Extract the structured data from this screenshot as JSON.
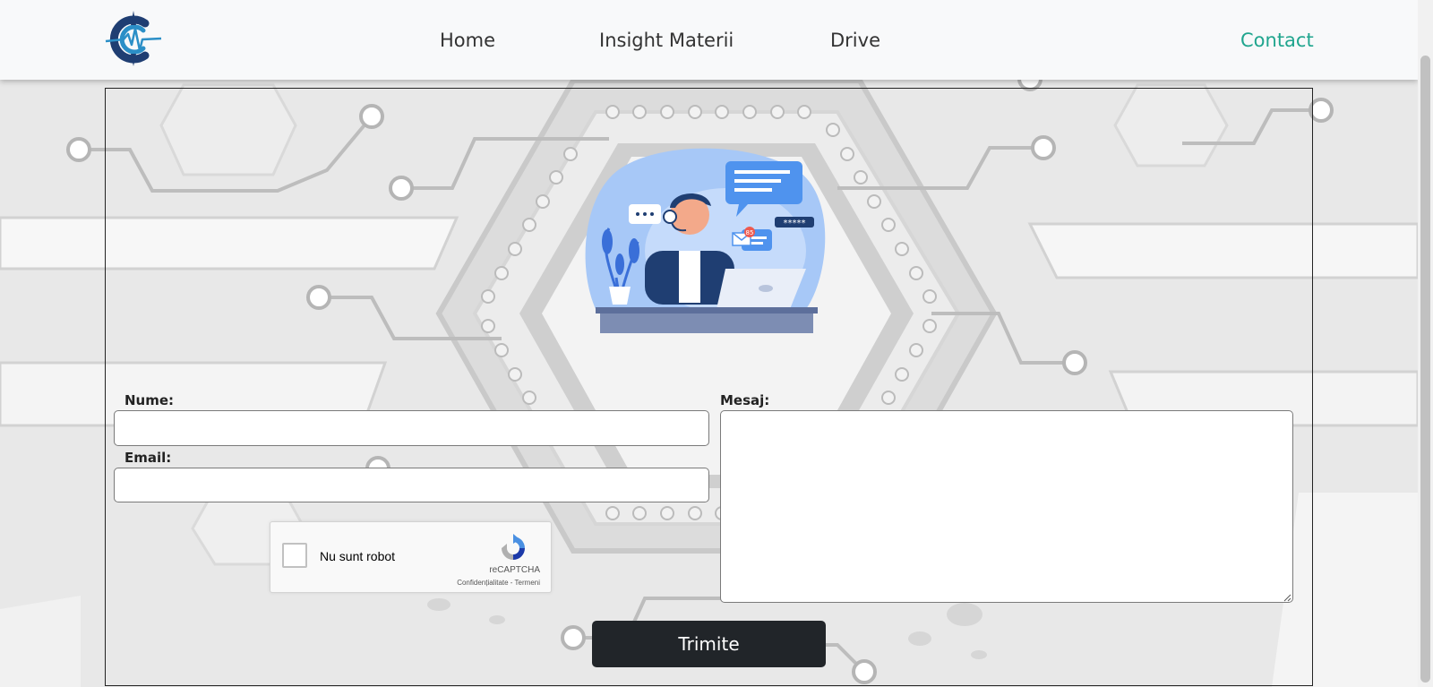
{
  "nav": {
    "links": [
      {
        "label": "Home",
        "active": false
      },
      {
        "label": "Insight Materii",
        "active": false
      },
      {
        "label": "Drive",
        "active": false
      },
      {
        "label": "Contact",
        "active": true
      }
    ],
    "accent_color": "#20a58e"
  },
  "form": {
    "name_label": "Nume:",
    "name_value": "",
    "email_label": "Email:",
    "email_value": "",
    "message_label": "Mesaj:",
    "message_value": "",
    "submit_label": "Trimite"
  },
  "recaptcha": {
    "label": "Nu sunt robot",
    "brand": "reCAPTCHA",
    "privacy": "Confidențialitate",
    "separator": " - ",
    "terms": "Termeni"
  },
  "colors": {
    "button_bg": "#212529",
    "navbar_bg": "#f8f9fa"
  },
  "illustration": {
    "icon": "customer-support-illustration",
    "password_mask": "*****",
    "badge_count": "85"
  }
}
